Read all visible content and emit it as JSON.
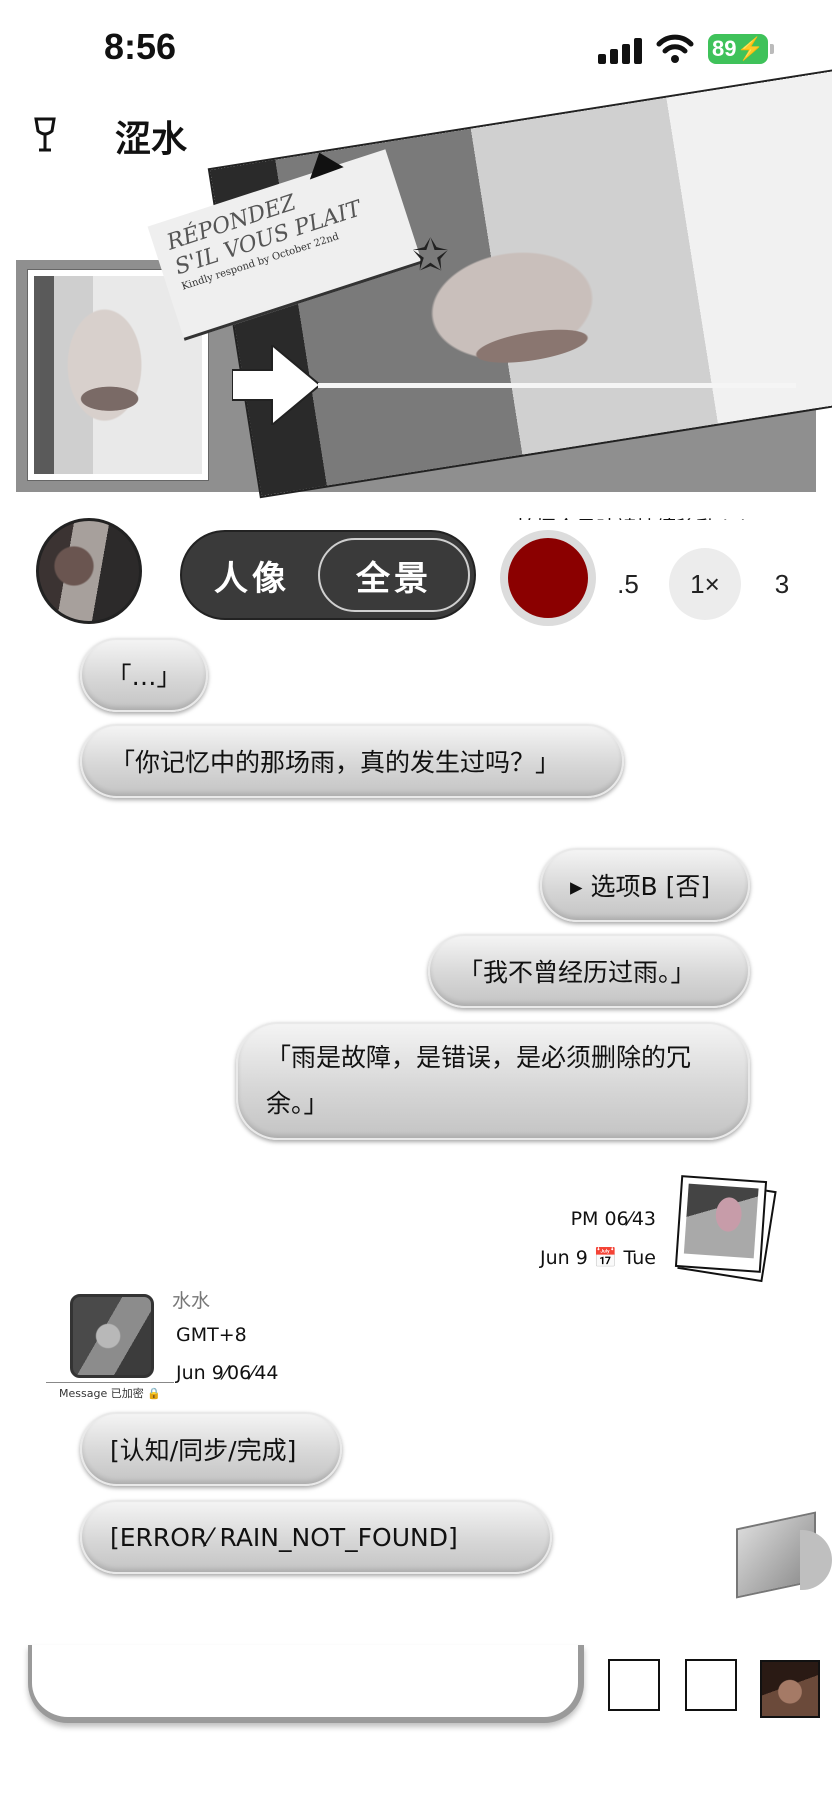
{
  "status_bar": {
    "time": "8:56",
    "battery": "89"
  },
  "header": {
    "title": "涩水"
  },
  "banner": {
    "card_text_line1": "RÉPONDEZ",
    "card_text_line2": "S'IL VOUS PLAIT",
    "card_small": "Kindly respond by October 22nd",
    "caption": "拍攝全景時請持續移動 iPhone。"
  },
  "camera": {
    "mode_portrait": "人像",
    "mode_pano": "全景",
    "zoom": [
      ".5",
      "1×",
      "3"
    ]
  },
  "messages": [
    {
      "text": "「…」"
    },
    {
      "text": "「你记忆中的那场雨，真的发生过吗？」"
    },
    {
      "text": "▸ 选项B [否]"
    },
    {
      "text": "「我不曾经历过雨。」"
    },
    {
      "text": "「雨是故障，是错误，是必须删除的冗余。」"
    },
    {
      "text": "[认知/同步/完成]"
    },
    {
      "text": "[ERROR⁄ RAIN_NOT_FOUND]"
    }
  ],
  "timestamp": {
    "time": "PM 06⁄43",
    "date": "Jun 9 📅 Tue"
  },
  "contact": {
    "name": "水水",
    "timezone": "GMT+8",
    "date": "Jun 9⁄06⁄44",
    "encryption": "Message 已加密 🔒"
  },
  "composer": {
    "placeholder": ""
  }
}
